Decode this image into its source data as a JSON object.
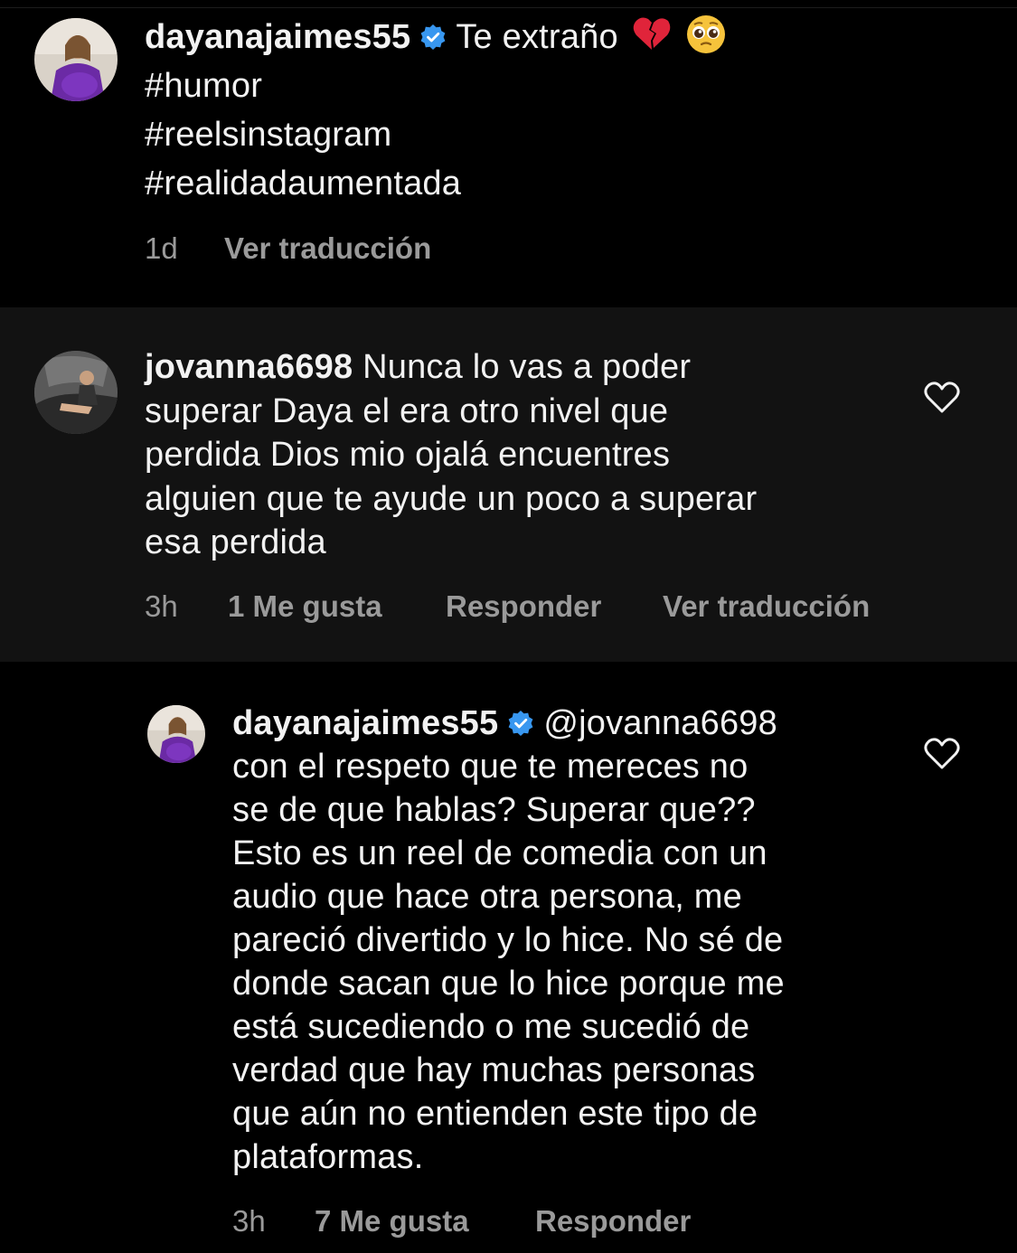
{
  "caption": {
    "username": "dayanajaimes55",
    "verified": true,
    "text": "Te extraño",
    "emojis": [
      "broken-heart",
      "pleading-face"
    ],
    "hashtags": [
      "#humor",
      "#reelsinstagram",
      "#realidadaumentada"
    ],
    "time": "1d",
    "translate": "Ver traducción"
  },
  "comment": {
    "username": "jovanna6698",
    "lines": [
      "Nunca lo vas a poder",
      "superar Daya el era otro nivel que",
      "perdida Dios mio ojalá encuentres",
      "alguien que te ayude un poco a superar",
      "esa perdida"
    ],
    "time": "3h",
    "likes": "1 Me gusta",
    "reply": "Responder",
    "translate": "Ver traducción"
  },
  "reply": {
    "username": "dayanajaimes55",
    "verified": true,
    "mention": "@jovanna6698",
    "lines": [
      "con el respeto que te mereces no",
      "se de que hablas? Superar que??",
      "Esto es un reel de comedia con un",
      "audio que hace otra persona, me",
      "pareció divertido y lo hice. No sé de",
      "donde sacan que lo hice porque me",
      "está sucediendo o me sucedió de",
      "verdad que hay muchas personas",
      "que aún no entienden este tipo de",
      "plataformas."
    ],
    "time": "3h",
    "likes": "7 Me gusta",
    "reply": "Responder"
  },
  "colors": {
    "background": "#000000",
    "comment_background": "#121212",
    "text": "#f2f2f2",
    "meta_text": "#9a9a9a",
    "verified_badge": "#3897f0"
  }
}
